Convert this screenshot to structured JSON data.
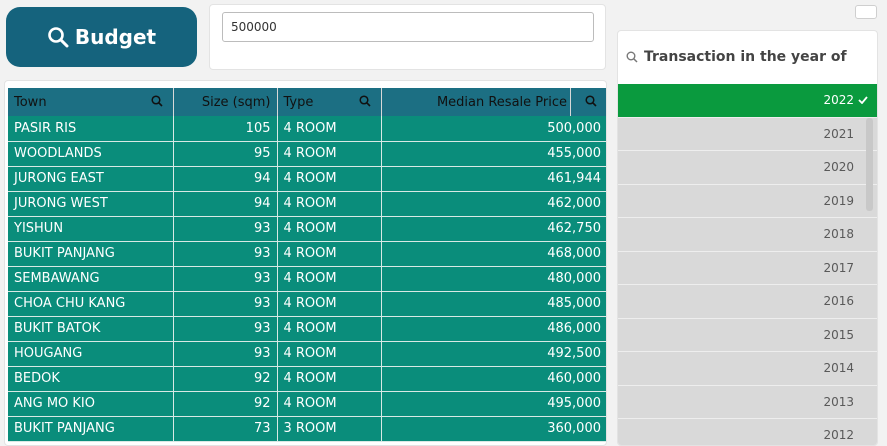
{
  "budget_button": {
    "label": "Budget"
  },
  "budget_input": {
    "value": "500000"
  },
  "table": {
    "headers": [
      "Town",
      "Size (sqm)",
      "Type",
      "Median Resale Price"
    ],
    "rows": [
      [
        "PASIR RIS",
        "105",
        "4 ROOM",
        "500,000"
      ],
      [
        "WOODLANDS",
        "95",
        "4 ROOM",
        "455,000"
      ],
      [
        "JURONG EAST",
        "94",
        "4 ROOM",
        "461,944"
      ],
      [
        "JURONG WEST",
        "94",
        "4 ROOM",
        "462,000"
      ],
      [
        "YISHUN",
        "93",
        "4 ROOM",
        "462,750"
      ],
      [
        "BUKIT PANJANG",
        "93",
        "4 ROOM",
        "468,000"
      ],
      [
        "SEMBAWANG",
        "93",
        "4 ROOM",
        "480,000"
      ],
      [
        "CHOA CHU KANG",
        "93",
        "4 ROOM",
        "485,000"
      ],
      [
        "BUKIT BATOK",
        "93",
        "4 ROOM",
        "486,000"
      ],
      [
        "HOUGANG",
        "93",
        "4 ROOM",
        "492,500"
      ],
      [
        "BEDOK",
        "92",
        "4 ROOM",
        "460,000"
      ],
      [
        "ANG MO KIO",
        "92",
        "4 ROOM",
        "495,000"
      ],
      [
        "BUKIT PANJANG",
        "73",
        "3 ROOM",
        "360,000"
      ]
    ]
  },
  "year_filter": {
    "title": "Transaction in the year of",
    "years": [
      "2022",
      "2021",
      "2020",
      "2019",
      "2018",
      "2017",
      "2016",
      "2015",
      "2014",
      "2013",
      "2012"
    ],
    "selected": "2022"
  },
  "colors": {
    "budget_button": "#15637d",
    "table_header": "#1c6f83",
    "table_row": "#0a8d7b",
    "selected_year": "#0a9a3e",
    "year_item": "#d9d9d9"
  }
}
